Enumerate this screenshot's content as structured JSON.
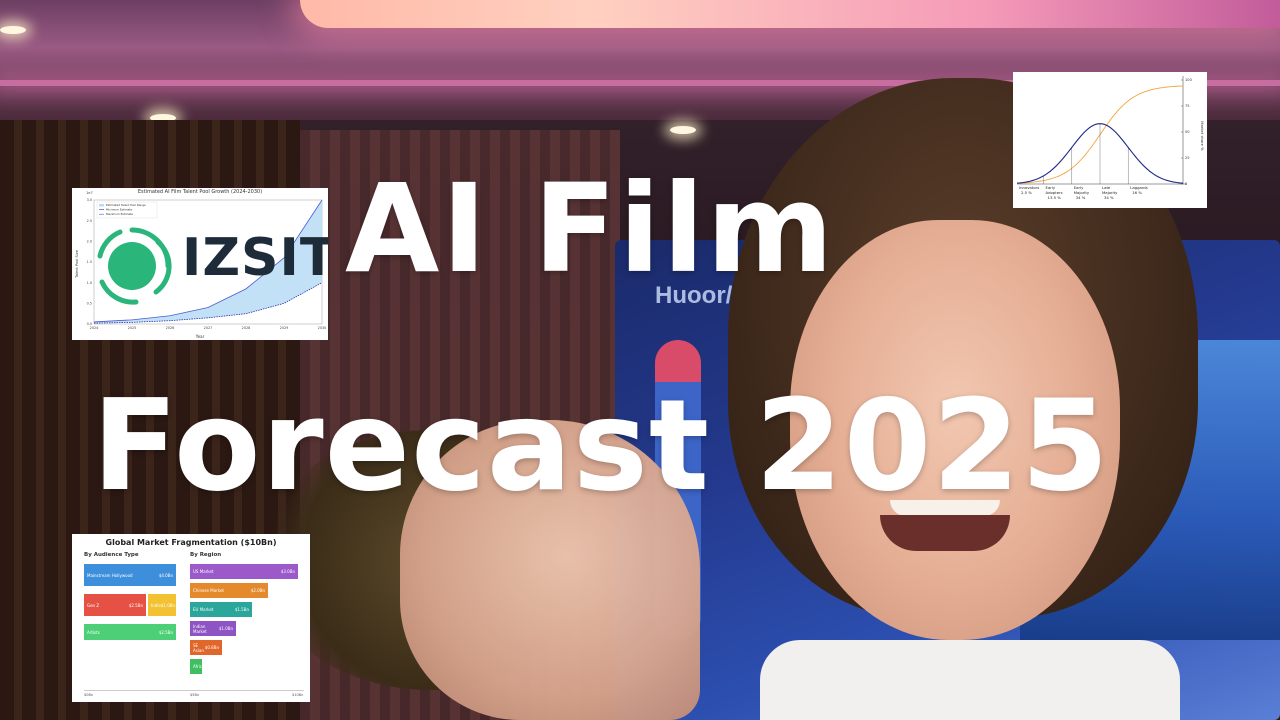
{
  "title": {
    "line1": "AI Film",
    "line2": "Forecast 2025"
  },
  "background": {
    "screen_text": "Huoor/e",
    "colors": {
      "neon": "#f59ab8",
      "screen": "#2c4fb0",
      "sidebar_accent": "#d84c6a"
    }
  },
  "logo": {
    "text": "IZSIT",
    "mark_color": "#2ab67a",
    "text_color": "#1d2c38"
  },
  "chart_data": [
    {
      "type": "area",
      "title": "Estimated AI Film Talent Pool Growth (2024-2030)",
      "xlabel": "Year",
      "ylabel": "Talent Pool Size",
      "scale_label": "1e7",
      "x": [
        2024,
        2025,
        2026,
        2027,
        2028,
        2029,
        2030
      ],
      "ylim": [
        0,
        3.0
      ],
      "yticks": [
        "0.0",
        "0.5",
        "1.0",
        "1.5",
        "2.0",
        "2.5",
        "3.0"
      ],
      "legend": [
        "Estimated Talent Pool Range",
        "Minimum Estimate",
        "Maximum Estimate"
      ],
      "series": [
        {
          "name": "Minimum Estimate",
          "values": [
            0.02,
            0.04,
            0.08,
            0.15,
            0.25,
            0.5,
            1.0
          ]
        },
        {
          "name": "Maximum Estimate",
          "values": [
            0.05,
            0.1,
            0.2,
            0.4,
            0.85,
            1.6,
            3.0
          ]
        }
      ],
      "colors": {
        "fill": "#b7dcf4",
        "min": "#2433a8",
        "max": "#4a5bd6"
      }
    },
    {
      "type": "line",
      "title": "",
      "ylabel": "Market share %",
      "ylim": [
        0,
        100
      ],
      "yticks": [
        "0",
        "25",
        "50",
        "75",
        "100"
      ],
      "segments": [
        {
          "label": "Innovators",
          "pct": "2.5 %"
        },
        {
          "label": "Early Adopters",
          "pct": "13.5 %"
        },
        {
          "label": "Early Majority",
          "pct": "34 %"
        },
        {
          "label": "Late Majority",
          "pct": "34 %"
        },
        {
          "label": "Laggards",
          "pct": "16 %"
        }
      ],
      "colors": {
        "bell": "#1d2a8a",
        "cumulative": "#f2a53a"
      }
    },
    {
      "type": "bar",
      "title": "Global Market Fragmentation ($10Bn)",
      "groups": [
        {
          "name": "By Audience Type",
          "items": [
            {
              "label": "Mainstream Hollywood",
              "value": "$4.0Bn",
              "color": "#3d8fdc"
            },
            {
              "label": "Gen Z",
              "value": "$2.5Bn",
              "color": "#e55245"
            },
            {
              "label": "Indie",
              "value": "$1.0Bn",
              "color": "#f2c232"
            },
            {
              "label": "Artists",
              "value": "$2.5Bn",
              "color": "#4ccf77"
            }
          ]
        },
        {
          "name": "By Region",
          "items": [
            {
              "label": "US Market",
              "value": "$3.0Bn",
              "color": "#9b59c9"
            },
            {
              "label": "Chinese Market",
              "value": "$2.0Bn",
              "color": "#e58a2c"
            },
            {
              "label": "EU Market",
              "value": "$1.5Bn",
              "color": "#2aa69a"
            },
            {
              "label": "Indian Market",
              "value": "$1.0Bn",
              "color": "#8e54c4"
            },
            {
              "label": "SE Asian",
              "value": "$0.8Bn",
              "color": "#e0662a"
            },
            {
              "label": "Afric",
              "value": "$0",
              "color": "#3fbf60"
            }
          ]
        }
      ],
      "axis_ticks": [
        "$0Bn",
        "$5Bn",
        "$10Bn"
      ]
    }
  ]
}
